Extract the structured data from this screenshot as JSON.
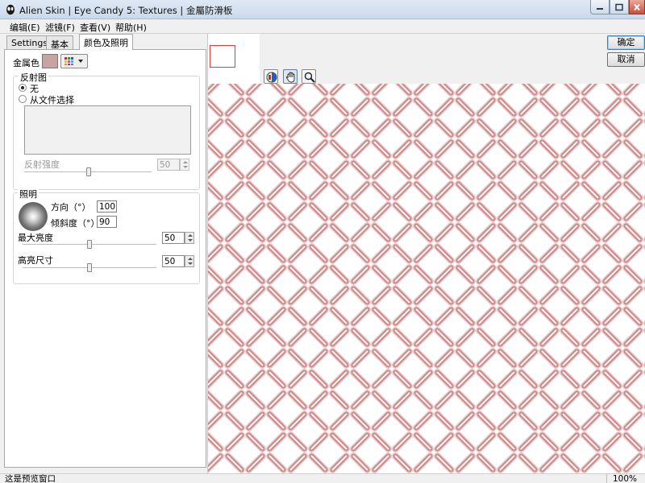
{
  "window": {
    "title": "Alien Skin | Eye Candy 5: Textures | 金屬防滑板",
    "icon": "alien-skin-app-icon",
    "controls": [
      "minimize-icon",
      "maximize-icon",
      "close-icon"
    ]
  },
  "menu": [
    "编辑(E)",
    "滤镜(F)",
    "查看(V)",
    "帮助(H)"
  ],
  "tabs": [
    {
      "label": "Settings",
      "active": false
    },
    {
      "label": "基本",
      "active": false
    },
    {
      "label": "颜色及照明",
      "active": true
    }
  ],
  "panel": {
    "metal_color_label": "金属色",
    "metal_color": "#c9a2a2",
    "reflection": {
      "title": "反射图",
      "option_none": "无",
      "option_file": "从文件选择",
      "selected": "option_none",
      "strength_label": "反射强度",
      "strength_value": "50",
      "strength_fraction": 0.5
    },
    "lighting": {
      "title": "照明",
      "direction_label": "方向（°）",
      "direction_value": "100",
      "tilt_label": "倾斜度（°）",
      "tilt_value": "90",
      "max_brightness_label": "最大亮度",
      "max_brightness_value": "50",
      "max_brightness_fraction": 0.5,
      "highlight_size_label": "高亮尺寸",
      "highlight_size_value": "50",
      "highlight_size_fraction": 0.5
    }
  },
  "buttons": {
    "ok": "确定",
    "cancel": "取消"
  },
  "tools": [
    "compare-icon",
    "hand-tool-icon",
    "zoom-tool-icon"
  ],
  "status": {
    "text": "这是预览窗口",
    "zoom": "100%"
  },
  "preview": {
    "texture": "diamond plate",
    "tint": "#c98a8a"
  }
}
